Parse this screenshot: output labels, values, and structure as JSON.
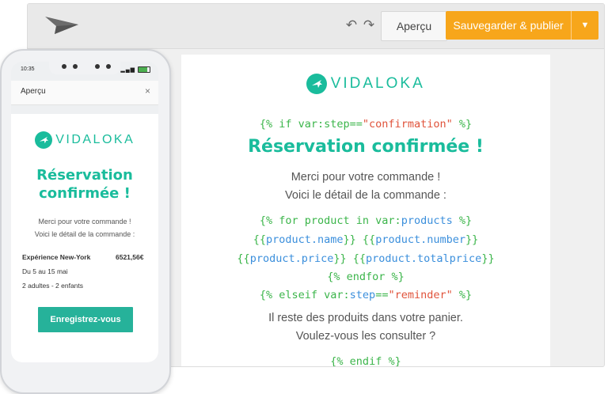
{
  "toolbar": {
    "apercu_label": "Aperçu",
    "save_label": "Sauvegarder & publier"
  },
  "brand": {
    "name": "VIDALOKA"
  },
  "email": {
    "line1": [
      "{% if var:step==",
      "\"confirmation\"",
      " %}"
    ],
    "title": "Réservation confirmée !",
    "para1": [
      "Merci pour votre commande !",
      "Voici le détail de la commande :"
    ],
    "code_for": [
      "{% for product in var:",
      "products",
      " %}"
    ],
    "code_name": [
      "{{",
      "product.name",
      "}} {{",
      "product.number",
      "}}"
    ],
    "code_price": [
      "{{",
      "product.price",
      "}} {{",
      "product.totalprice",
      "}}"
    ],
    "code_endfor": "{% endfor %}",
    "code_elseif": [
      "{% elseif var:",
      "step",
      "==",
      "\"reminder\"",
      " %}"
    ],
    "para2": [
      "Il reste des produits dans votre panier.",
      "Voulez-vous les consulter ?"
    ],
    "code_endif": "{% endif %}"
  },
  "phone": {
    "time": "10:35",
    "header_title": "Aperçu",
    "close": "×",
    "title_lines": [
      "Réservation",
      "confirmée !"
    ],
    "text_lines": [
      "Merci pour votre commande !",
      "Voici le détail de la commande :"
    ],
    "product_name": "Expérience New-York",
    "product_price": "6521,56€",
    "dates": "Du 5 au 15 mai",
    "people": "2 adultes - 2 enfants",
    "cta": "Enregistrez-vous"
  },
  "colors": {
    "accent": "#1abc9c",
    "orange": "#f7a61b",
    "code_green": "#3bb54a",
    "code_blue": "#3b8fdc",
    "code_red": "#e0533b"
  }
}
